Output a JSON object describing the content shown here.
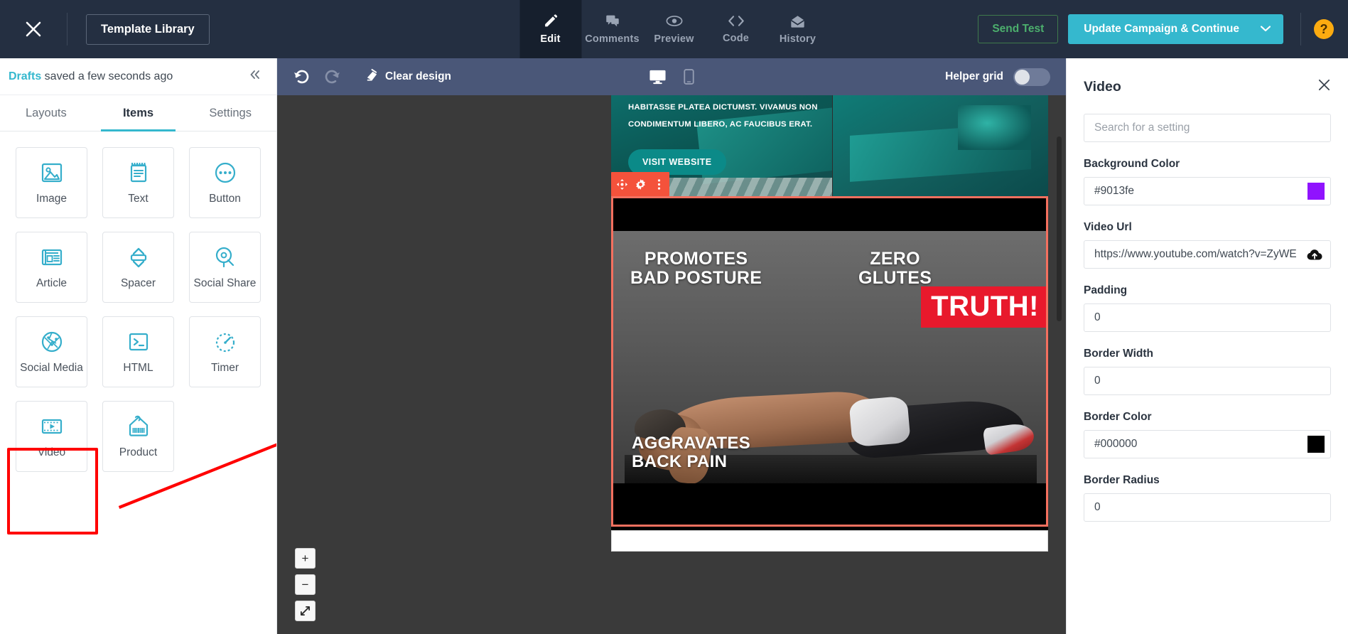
{
  "topbar": {
    "close_icon": "close-icon",
    "template_library_label": "Template Library",
    "nav": [
      {
        "label": "Edit",
        "icon": "pencil-icon",
        "active": true
      },
      {
        "label": "Comments",
        "icon": "comments-icon",
        "active": false
      },
      {
        "label": "Preview",
        "icon": "eye-icon",
        "active": false
      },
      {
        "label": "Code",
        "icon": "code-icon",
        "active": false
      },
      {
        "label": "History",
        "icon": "envelope-open-icon",
        "active": false
      }
    ],
    "send_test_label": "Send Test",
    "update_label": "Update Campaign & Continue",
    "update_caret": "˅",
    "help_label": "?",
    "accent_teal": "#35b8ce",
    "send_test_green": "#4caf6d",
    "help_orange": "#fcab10",
    "bar_bg": "#242f41"
  },
  "sidebar": {
    "status_prefix": "Drafts",
    "status_suffix": " saved a few seconds ago",
    "collapse_icon": "collapse-panel-icon",
    "tabs": [
      {
        "label": "Layouts",
        "active": false
      },
      {
        "label": "Items",
        "active": true
      },
      {
        "label": "Settings",
        "active": false
      }
    ],
    "items": [
      {
        "label": "Image",
        "icon": "image-icon"
      },
      {
        "label": "Text",
        "icon": "notepad-icon"
      },
      {
        "label": "Button",
        "icon": "button-ellipsis-icon"
      },
      {
        "label": "Article",
        "icon": "article-icon"
      },
      {
        "label": "Spacer",
        "icon": "spacer-icon"
      },
      {
        "label": "Social Share",
        "icon": "social-share-icon"
      },
      {
        "label": "Social Media",
        "icon": "globe-network-icon"
      },
      {
        "label": "HTML",
        "icon": "terminal-icon"
      },
      {
        "label": "Timer",
        "icon": "timer-icon"
      },
      {
        "label": "Video",
        "icon": "video-play-icon",
        "highlighted": true
      },
      {
        "label": "Product",
        "icon": "price-tag-icon"
      }
    ],
    "annotation": {
      "box_color": "#ff0000",
      "arrow_color": "#ff0000"
    }
  },
  "canvas_toolbar": {
    "undo_icon": "undo-icon",
    "redo_icon": "redo-icon",
    "clear_design_label": "Clear design",
    "clear_design_icon": "eraser-icon",
    "desktop_icon": "desktop-icon",
    "mobile_icon": "mobile-icon",
    "helper_grid_label": "Helper grid",
    "helper_grid_on": false,
    "bar_bg": "#4a5778"
  },
  "canvas": {
    "zoom_in_label": "+",
    "zoom_out_label": "−",
    "fit_icon": "expand-icon",
    "element_toolbar": {
      "move_icon": "move-icon",
      "settings_icon": "gear-icon",
      "more_icon": "more-vertical-icon",
      "color": "#f4523b"
    },
    "hero": {
      "paragraph_line1": "HABITASSE PLATEA DICTUMST. VIVAMUS NON",
      "paragraph_line2": "CONDIMENTUM LIBERO, AC FAUCIBUS ERAT.",
      "cta_label": "VISIT WEBSITE"
    },
    "video_block": {
      "selected": true,
      "selection_color": "#f4705f",
      "overlay_texts": {
        "top_left_line1": "PROMOTES",
        "top_left_line2": "BAD POSTURE",
        "top_right_line1": "ZERO",
        "top_right_line2": "GLUTES",
        "badge": "TRUTH!",
        "bottom_line1": "AGGRAVATES",
        "bottom_line2": "BACK PAIN"
      },
      "arrow_color": "#f5c518",
      "badge_color": "#e8192c"
    }
  },
  "settings_panel": {
    "title": "Video",
    "close_icon": "close-icon",
    "search_placeholder": "Search for a setting",
    "fields": [
      {
        "label": "Background Color",
        "value": "#9013fe",
        "swatch": "#9013fe",
        "type": "color"
      },
      {
        "label": "Video Url",
        "value": "https://www.youtube.com/watch?v=ZyWEXjd",
        "type": "url",
        "icon": "cloud-upload-icon"
      },
      {
        "label": "Padding",
        "value": "0",
        "type": "number"
      },
      {
        "label": "Border Width",
        "value": "0",
        "type": "number"
      },
      {
        "label": "Border Color",
        "value": "#000000",
        "swatch": "#000000",
        "type": "color"
      },
      {
        "label": "Border Radius",
        "value": "0",
        "type": "number"
      }
    ]
  }
}
